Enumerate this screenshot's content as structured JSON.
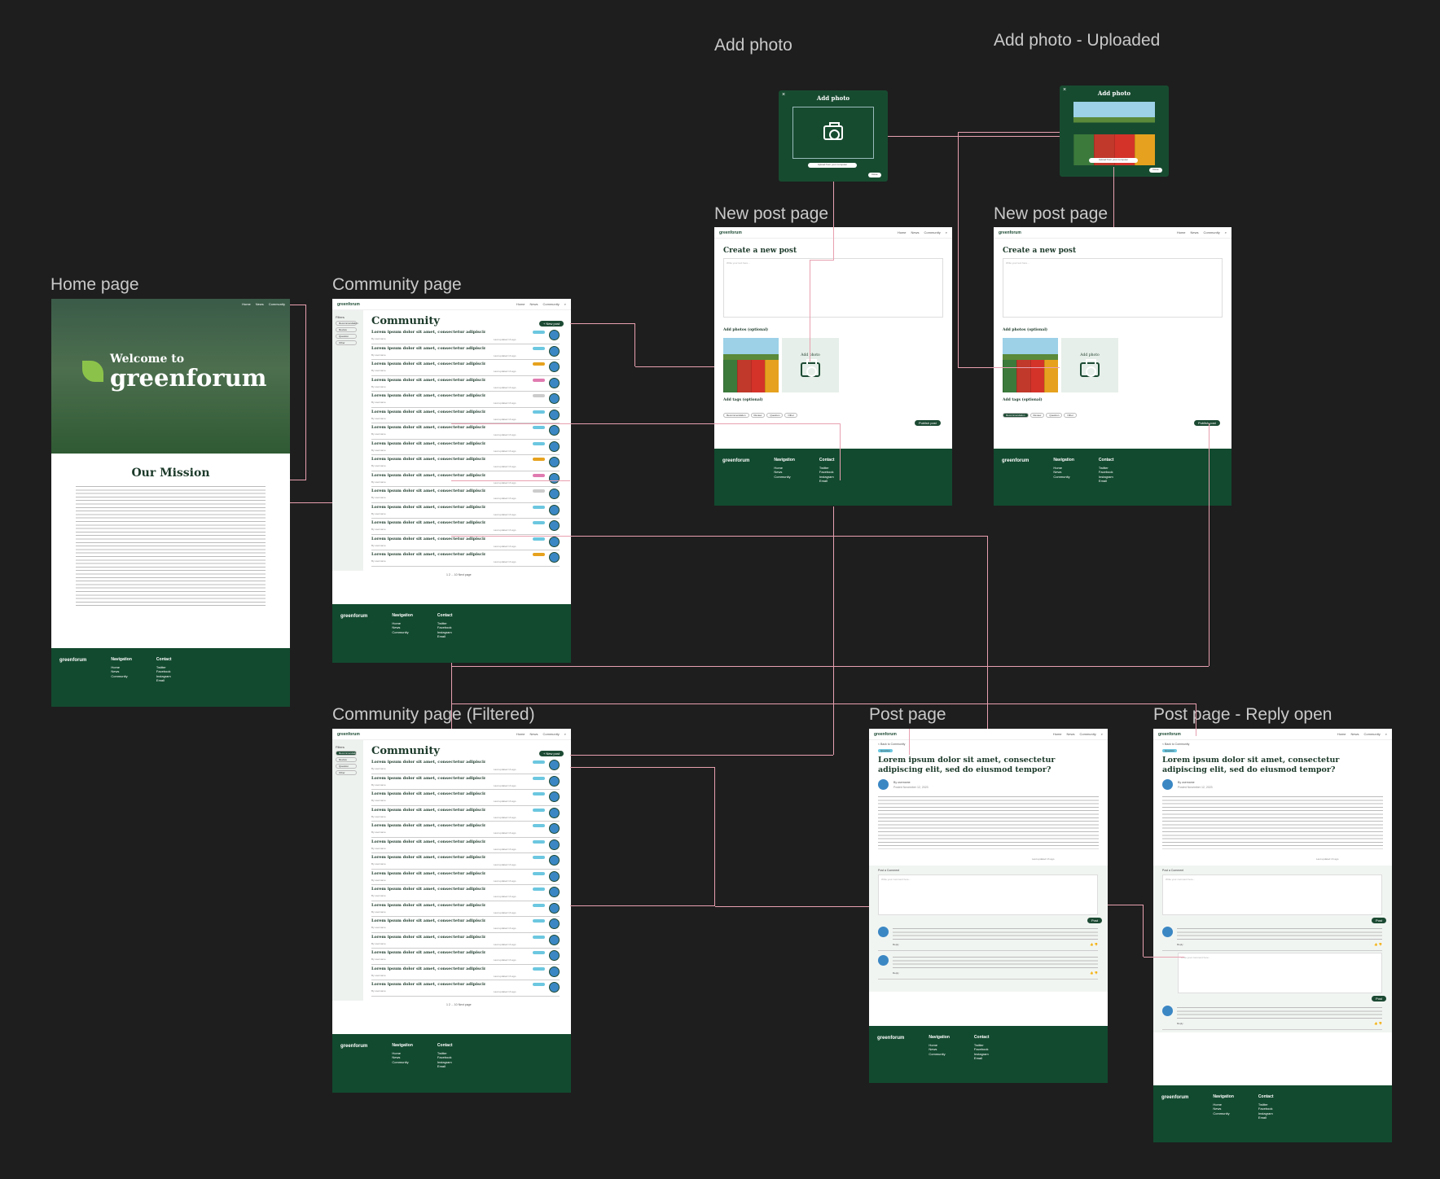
{
  "labels": {
    "home": "Home page",
    "community": "Community page",
    "community_filtered": "Community page (Filtered)",
    "new_post_1": "New post page",
    "new_post_2": "New post page",
    "add_photo": "Add photo",
    "add_photo_uploaded": "Add photo - Uploaded",
    "post": "Post page",
    "post_reply": "Post page - Reply open"
  },
  "brand": {
    "logo": "greenforum",
    "welcome": "Welcome to",
    "name": "greenforum"
  },
  "nav": {
    "items": [
      "Home",
      "News",
      "Community"
    ]
  },
  "home": {
    "mission_title": "Our Mission"
  },
  "footer": {
    "nav_title": "Navigation",
    "nav_items": [
      "Home",
      "News",
      "Community"
    ],
    "contact_title": "Contact",
    "contact_items": [
      "Twitter",
      "Facebook",
      "Instagram",
      "Email"
    ]
  },
  "community": {
    "title": "Community",
    "new_post": "+ New post",
    "filter": "Filters",
    "post_title": "Lorem ipsum dolor sit amet, consectetur adipiscing elit ...",
    "author": "By username",
    "meta": "Last updated 1h ago",
    "pagination": "1 2 ... 10 Next page"
  },
  "new_post": {
    "title": "Create a new post",
    "placeholder": "Write your text here...",
    "add_photos": "Add photos (optional)",
    "add_photo_tile": "Add photo",
    "add_tags": "Add tags (optional)",
    "tags": [
      "Recommendation",
      "Review",
      "Question",
      "Other"
    ],
    "publish": "Publish post"
  },
  "add_photo_modal": {
    "title": "Add photo",
    "upload": "Upload from your computer",
    "done": "Done"
  },
  "post": {
    "back": "< Back to Community",
    "tag": "Question",
    "title": "Lorem ipsum dolor sit amet, consectetur adipiscing elit, sed do eiusmod tempor?",
    "author": "By username",
    "date": "Posted November 12, 2023",
    "meta": "Last updated 1h ago",
    "comment_label": "Post a Comment",
    "comment_placeholder": "Write your comment here...",
    "post_btn": "Post",
    "reply": "Reply"
  },
  "colors": {
    "canvas": "#1e1e1e",
    "brand_green": "#124a2f",
    "connector": "#e8a0b0"
  }
}
